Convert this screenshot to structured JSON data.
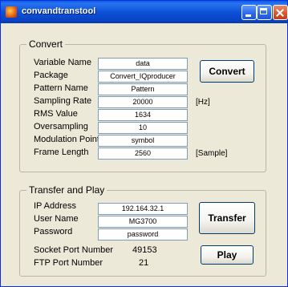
{
  "window": {
    "title": "convandtranstool"
  },
  "convert": {
    "legend": "Convert",
    "rows": [
      {
        "label": "Variable Name",
        "value": "data"
      },
      {
        "label": "Package",
        "value": "Convert_IQproducer"
      },
      {
        "label": "Pattern Name",
        "value": "Pattern"
      },
      {
        "label": "Sampling Rate",
        "value": "20000"
      },
      {
        "label": "RMS Value",
        "value": "1634"
      },
      {
        "label": "Oversampling",
        "value": "10"
      },
      {
        "label": "Modulation Point",
        "value": "symbol"
      },
      {
        "label": "Frame Length",
        "value": "2560"
      }
    ],
    "sampling_rate_unit": "[Hz]",
    "frame_length_unit": "[Sample]",
    "button_label": "Convert"
  },
  "transfer": {
    "legend": "Transfer and Play",
    "rows": [
      {
        "label": "IP Address",
        "value": "192.164.32.1"
      },
      {
        "label": "User Name",
        "value": "MG3700"
      },
      {
        "label": "Password",
        "value": "password"
      }
    ],
    "socket_port_label": "Socket Port Number",
    "socket_port_value": "49153",
    "ftp_port_label": "FTP Port Number",
    "ftp_port_value": "21",
    "transfer_button_label": "Transfer",
    "play_button_label": "Play"
  },
  "icons": {
    "app": "app-icon",
    "minimize": "minimize-icon",
    "maximize": "maximize-icon",
    "close": "close-icon"
  }
}
